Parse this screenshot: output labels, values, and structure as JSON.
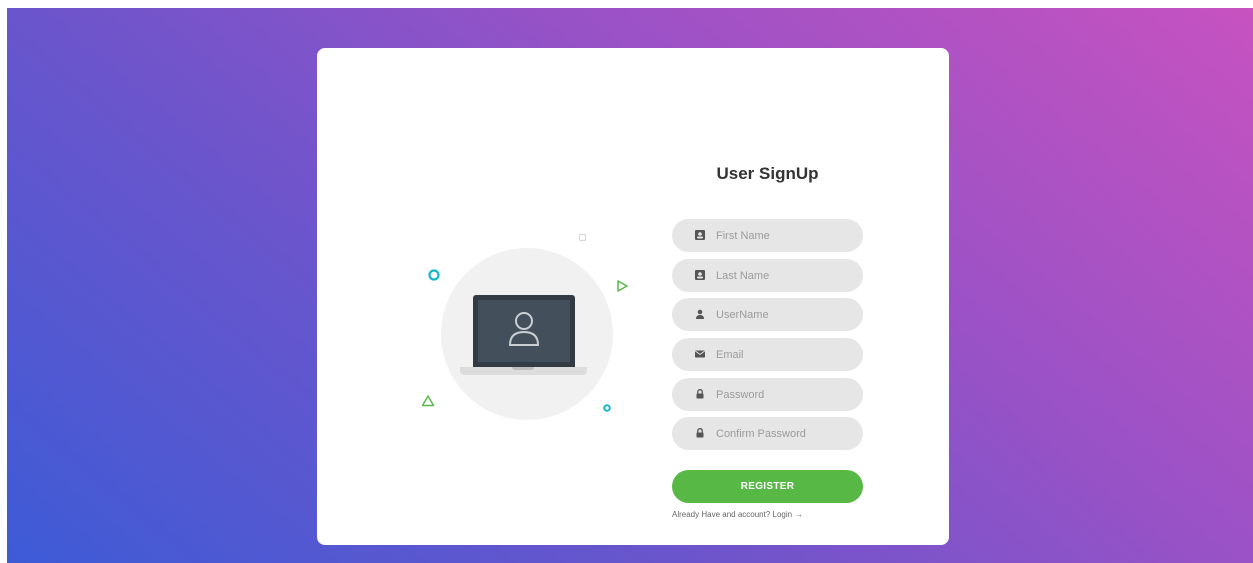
{
  "form": {
    "title": "User SignUp",
    "fields": [
      {
        "placeholder": "First Name",
        "icon": "id-card-icon"
      },
      {
        "placeholder": "Last Name",
        "icon": "id-card-icon"
      },
      {
        "placeholder": "UserName",
        "icon": "user-icon"
      },
      {
        "placeholder": "Email",
        "icon": "envelope-icon"
      },
      {
        "placeholder": "Password",
        "icon": "lock-icon"
      },
      {
        "placeholder": "Confirm Password",
        "icon": "lock-icon"
      }
    ],
    "register_label": "REGISTER",
    "login_prompt": "Already Have and account? Login",
    "login_arrow": "→"
  },
  "colors": {
    "accent_green": "#57b846",
    "field_bg": "#e6e6e6",
    "gradient_start": "#3d5bd6",
    "gradient_end": "#c752c0"
  }
}
